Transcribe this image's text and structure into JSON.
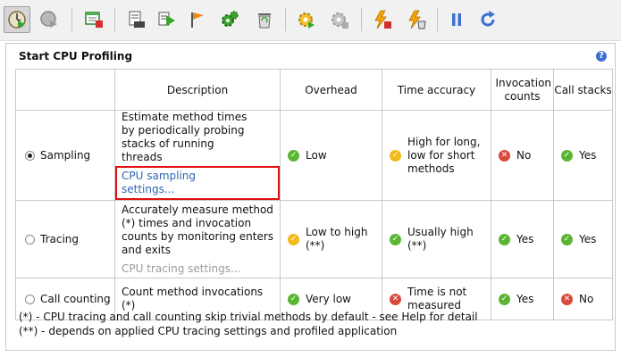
{
  "toolbar": {
    "buttons": [
      {
        "icon": "cpu-profiling-icon",
        "active": true
      },
      {
        "icon": "memory-profiling-icon"
      },
      {
        "icon": "window-settings-icon"
      },
      {
        "icon": "dump-icon"
      },
      {
        "icon": "play-settings-icon"
      },
      {
        "icon": "flag-icon"
      },
      {
        "icon": "gear-green-icon"
      },
      {
        "icon": "trash-icon"
      },
      {
        "icon": "gear-yellow-icon"
      },
      {
        "icon": "gear-grey-icon"
      },
      {
        "icon": "lightning-stop-icon"
      },
      {
        "icon": "lightning-trash-icon"
      },
      {
        "icon": "pause-icon"
      },
      {
        "icon": "refresh-icon"
      }
    ]
  },
  "panel": {
    "title": "Start CPU Profiling",
    "help": "?"
  },
  "table": {
    "headers": [
      "",
      "Description",
      "Overhead",
      "Time accuracy",
      "Invocation counts",
      "Call stacks"
    ],
    "rows": [
      {
        "mode": "Sampling",
        "selected": true,
        "description": "Estimate method times by periodically probing stacks of running threads",
        "settings_link": "CPU sampling settings...",
        "overhead": {
          "status": "ok",
          "text": "Low"
        },
        "time_accuracy": {
          "status": "warn",
          "text": "High for long, low for short methods"
        },
        "invocation_counts": {
          "status": "no",
          "text": "No"
        },
        "call_stacks": {
          "status": "ok",
          "text": "Yes"
        }
      },
      {
        "mode": "Tracing",
        "selected": false,
        "description": "Accurately measure method (*) times and invocation counts by monitoring enters and exits",
        "settings_link": "CPU tracing settings...",
        "overhead": {
          "status": "warn",
          "text": "Low to high (**)"
        },
        "time_accuracy": {
          "status": "ok",
          "text": "Usually high (**)"
        },
        "invocation_counts": {
          "status": "ok",
          "text": "Yes"
        },
        "call_stacks": {
          "status": "ok",
          "text": "Yes"
        }
      },
      {
        "mode": "Call counting",
        "selected": false,
        "description": "Count method invocations (*)",
        "overhead": {
          "status": "ok",
          "text": "Very low"
        },
        "time_accuracy": {
          "status": "no",
          "text": "Time is not measured"
        },
        "invocation_counts": {
          "status": "ok",
          "text": "Yes"
        },
        "call_stacks": {
          "status": "no",
          "text": "No"
        }
      }
    ]
  },
  "footnotes": [
    "(*) - CPU tracing and call counting skip trivial methods by default - see Help for detail",
    "(**) - depends on applied CPU tracing settings and profiled application"
  ],
  "colors": {
    "ok": "#5bb533",
    "warn": "#f3b81c",
    "no": "#d9493a",
    "link": "#2f66b3",
    "highlight": "#e01010"
  }
}
